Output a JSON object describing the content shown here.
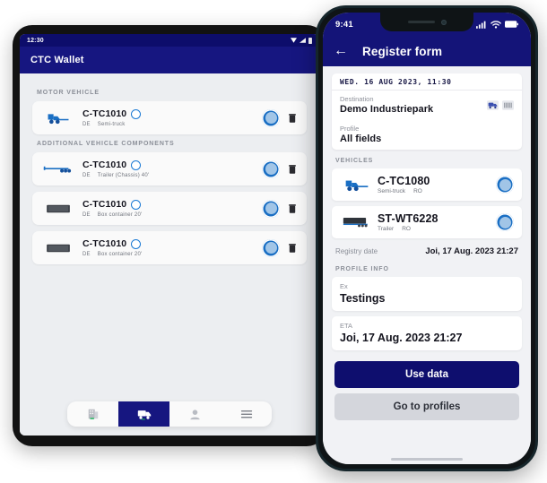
{
  "tablet": {
    "statusbar": {
      "time": "12:30",
      "icons": [
        "wifi-icon",
        "signal-icon",
        "battery-icon"
      ]
    },
    "header": {
      "title": "CTC Wallet"
    },
    "sections": [
      {
        "label": "MOTOR VEHICLE",
        "items": [
          {
            "icon": "semi-truck-icon",
            "plate": "C-TC1010",
            "country": "DE",
            "type": "Semi-truck",
            "status_icon": "ring-icon",
            "seal_icon": "seal-badge-icon",
            "delete_icon": "trash-icon"
          }
        ]
      },
      {
        "label": "ADDITIONAL VEHICLE COMPONENTS",
        "items": [
          {
            "icon": "trailer-chassis-icon",
            "plate": "C-TC1010",
            "country": "DE",
            "type": "Trailer (Chassis) 40'",
            "status_icon": "ring-icon",
            "seal_icon": "seal-badge-icon",
            "delete_icon": "trash-icon"
          },
          {
            "icon": "box-container-icon",
            "plate": "C-TC1010",
            "country": "DE",
            "type": "Box container 20'",
            "status_icon": "ring-icon",
            "seal_icon": "seal-badge-icon",
            "delete_icon": "trash-icon"
          },
          {
            "icon": "box-container-icon",
            "plate": "C-TC1010",
            "country": "DE",
            "type": "Box container 20'",
            "status_icon": "ring-icon",
            "seal_icon": "seal-badge-icon",
            "delete_icon": "trash-icon"
          }
        ]
      }
    ],
    "bottom_nav": [
      {
        "name": "company-icon",
        "active": false
      },
      {
        "name": "truck-icon",
        "active": true
      },
      {
        "name": "person-icon",
        "active": false
      },
      {
        "name": "menu-icon",
        "active": false
      }
    ]
  },
  "phone": {
    "statusbar": {
      "time": "9:41",
      "icons": [
        "signal-icon",
        "wifi-icon",
        "battery-icon"
      ]
    },
    "header": {
      "back_icon": "arrow-left-icon",
      "title": "Register form"
    },
    "datebar": {
      "value": "WED. 16 AUG 2023, 11:30"
    },
    "destination": {
      "label": "Destination",
      "value": "Demo Industriepark",
      "icons": [
        "truck-badge-icon",
        "container-badge-icon"
      ]
    },
    "profile": {
      "label": "Profile",
      "value": "All fields"
    },
    "vehicles": {
      "label": "VEHICLES",
      "items": [
        {
          "icon": "semi-truck-icon",
          "plate": "C-TC1080",
          "type": "Semi-truck",
          "country": "RO",
          "seal_icon": "seal-badge-icon"
        },
        {
          "icon": "trailer-icon",
          "plate": "ST-WT6228",
          "type": "Trailer",
          "country": "RO",
          "seal_icon": "seal-badge-icon"
        }
      ],
      "registry_label": "Registry date",
      "registry_value": "Joi, 17 Aug. 2023 21:27"
    },
    "profile_info": {
      "label": "PROFILE INFO",
      "fields": [
        {
          "label": "Ex",
          "value": "Testings"
        },
        {
          "label": "ETA",
          "value": "Joi, 17 Aug. 2023 21:27"
        }
      ]
    },
    "actions": {
      "primary": "Use data",
      "secondary": "Go to profiles"
    }
  },
  "colors": {
    "brand_navy": "#141478",
    "accent_blue": "#1979d4",
    "page_bg": "#f1f2f5"
  }
}
